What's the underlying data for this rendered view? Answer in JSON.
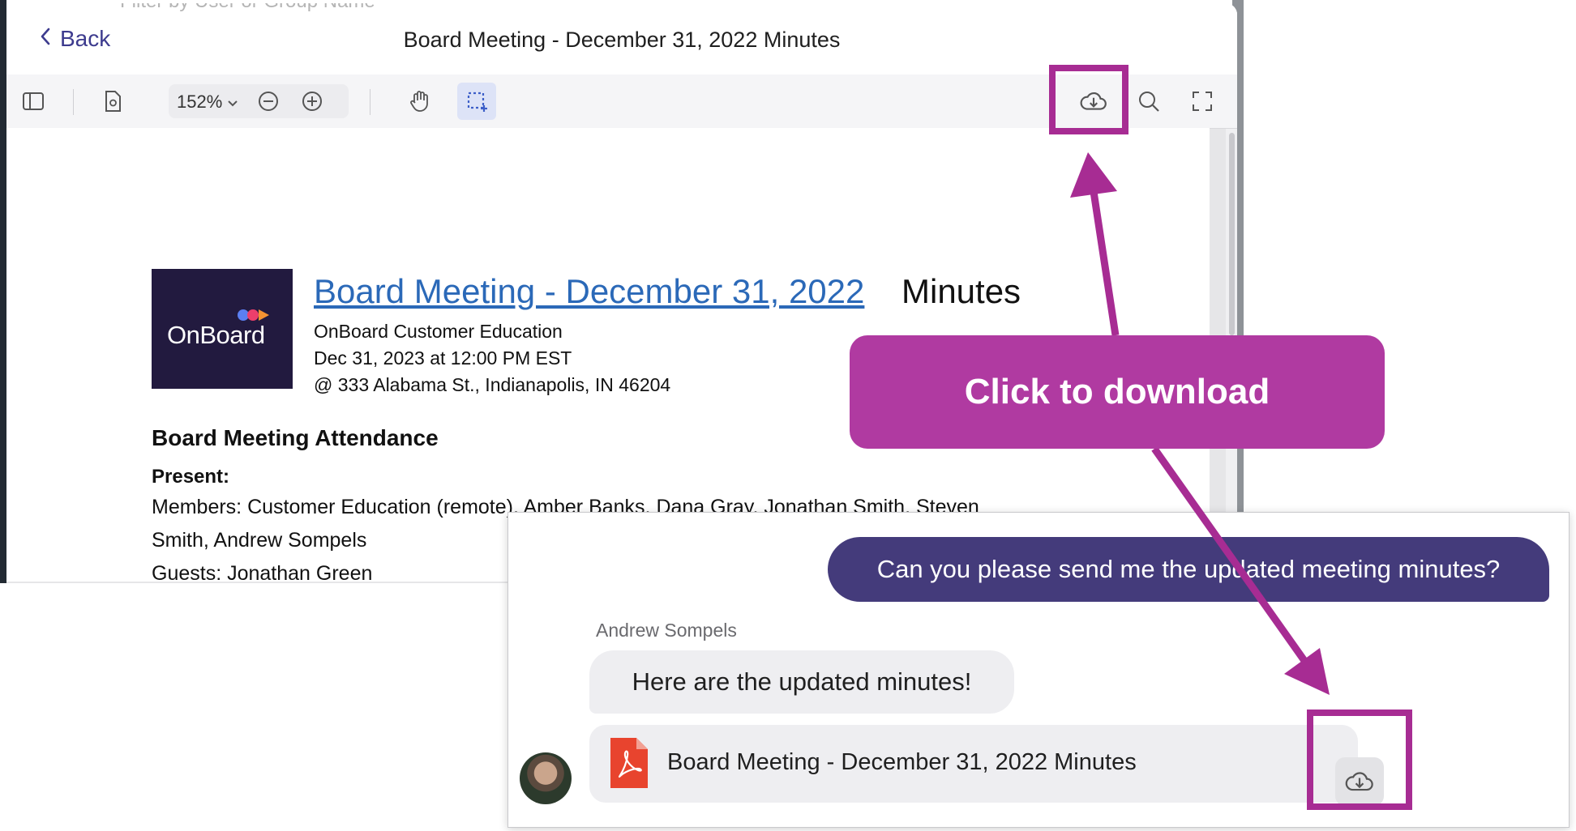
{
  "viewer": {
    "back_label": "Back",
    "title": "Board Meeting - December 31, 2022 Minutes",
    "background_placeholder": "Filter by User or Group Name",
    "toolbar": {
      "zoom_level": "152%",
      "icons": [
        "sidebar-toggle-icon",
        "page-settings-icon",
        "zoom-out-icon",
        "zoom-in-icon",
        "hand-tool-icon",
        "select-tool-icon",
        "cloud-download-icon",
        "search-icon",
        "fullscreen-icon"
      ]
    }
  },
  "document": {
    "logo_text": "OnBoard",
    "heading_link": "Board Meeting - December 31, 2022",
    "heading_suffix": "Minutes",
    "org": "OnBoard Customer Education",
    "datetime": "Dec 31, 2023 at 12:00 PM EST",
    "location": "@ 333 Alabama St., Indianapolis, IN 46204",
    "attendance_heading": "Board Meeting Attendance",
    "present_label": "Present:",
    "members_line1": "Members: Customer Education (remote), Amber Banks, Dana Gray, Jonathan Smith, Steven",
    "members_line2": "Smith, Andrew Sompels",
    "guests_line": "Guests: Jonathan Green"
  },
  "callout": {
    "text": "Click to download",
    "color": "#b03aa1"
  },
  "chat": {
    "outgoing_message": "Can you please send me the updated meeting minutes?",
    "sender_name": "Andrew Sompels",
    "reply_message": "Here are the updated minutes!",
    "attachment_name": "Board Meeting - December 31, 2022 Minutes",
    "attachment_icon": "pdf-icon"
  },
  "colors": {
    "highlight": "#a72c93",
    "outgoing_bubble": "#443b7b",
    "link": "#2b69b8",
    "logo_bg": "#221a3f"
  }
}
